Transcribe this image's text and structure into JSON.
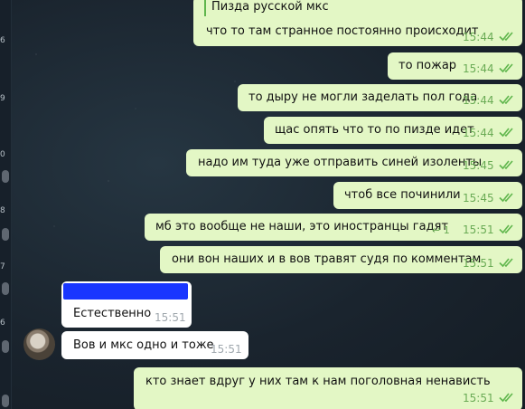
{
  "sidebar_fragments": [
    "6",
    "9",
    "0",
    "8",
    "7",
    "6"
  ],
  "messages": [
    {
      "id": "m1",
      "direction": "outgoing",
      "quote": "Пизда русской мкс",
      "text": "что то там странное постоянно происходит",
      "time": "15:44",
      "read": true
    },
    {
      "id": "m2",
      "direction": "outgoing",
      "text": "то пожар",
      "time": "15:44",
      "read": true
    },
    {
      "id": "m3",
      "direction": "outgoing",
      "text": "то дыру не могли заделать пол года",
      "time": "15:44",
      "read": true
    },
    {
      "id": "m4",
      "direction": "outgoing",
      "text": "щас опять что то по пизде идет",
      "time": "15:44",
      "read": true
    },
    {
      "id": "m5",
      "direction": "outgoing",
      "text": "надо им туда уже отправить синей изоленты",
      "time": "15:45",
      "read": true
    },
    {
      "id": "m6",
      "direction": "outgoing",
      "text": "чтоб все починили",
      "time": "15:45",
      "read": true
    },
    {
      "id": "m7",
      "direction": "outgoing",
      "text": "мб это вообще не наши, это иностранцы гадят",
      "time": "15:51",
      "read": true,
      "replies": "1"
    },
    {
      "id": "m8",
      "direction": "outgoing",
      "text": "они вон наших и в вов травят судя по комментам",
      "time": "15:51",
      "read": true
    },
    {
      "id": "m9",
      "direction": "incoming",
      "sender_redacted": true,
      "text": "Естественно",
      "time": "15:51"
    },
    {
      "id": "m10",
      "direction": "incoming",
      "text": "Вов и мкс одно и тоже",
      "time": "15:51"
    },
    {
      "id": "m11",
      "direction": "outgoing",
      "text": "кто знает вдруг у них там к нам поголовная ненависть",
      "time": "15:51",
      "read": true
    }
  ],
  "colors": {
    "outgoing_bubble": "#e3f7c5",
    "incoming_bubble": "#ffffff",
    "accent_green": "#5fb64c",
    "redaction": "#1936ff"
  }
}
